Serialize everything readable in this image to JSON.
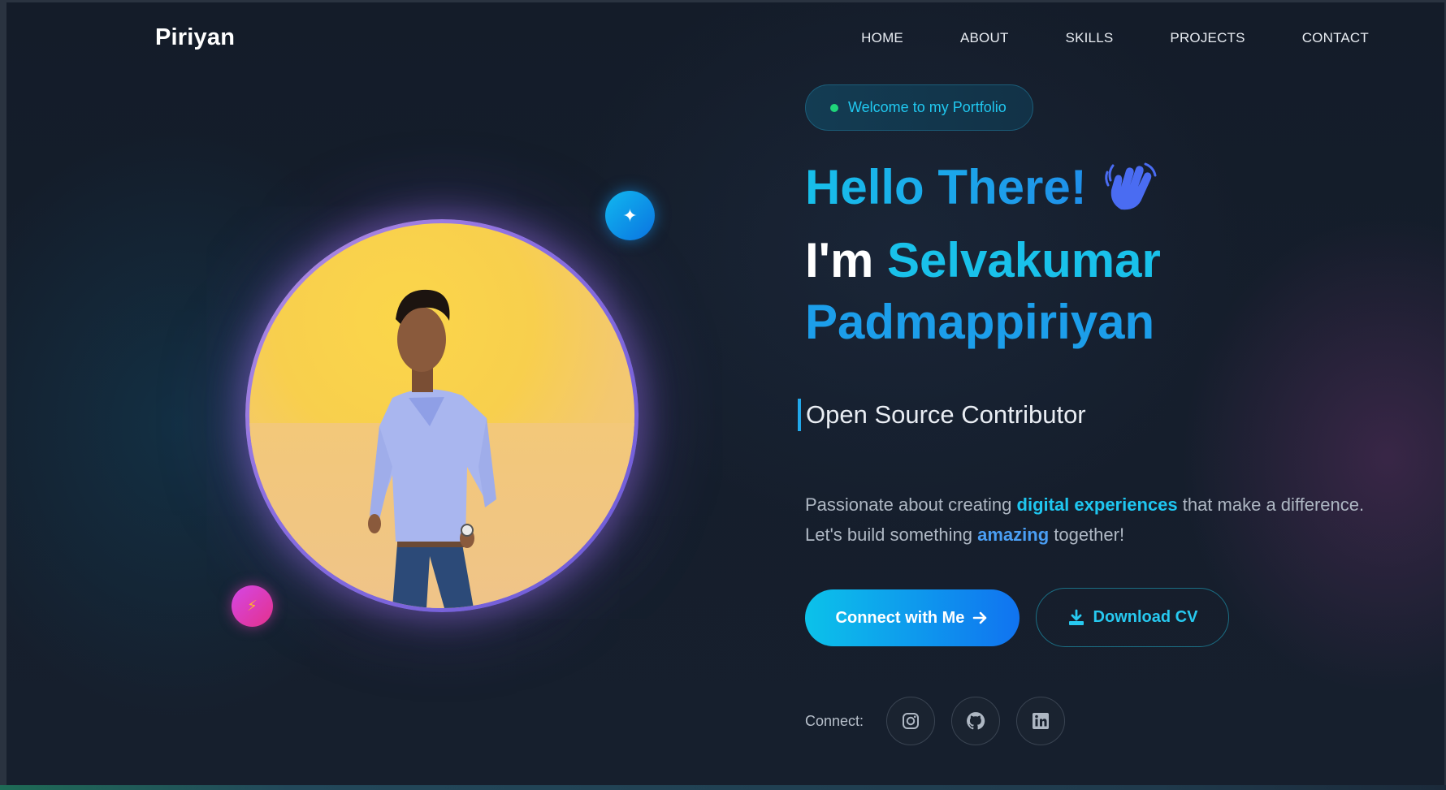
{
  "brand": {
    "logo": "Piriyan"
  },
  "nav": {
    "items": [
      "HOME",
      "ABOUT",
      "SKILLS",
      "PROJECTS",
      "CONTACT"
    ]
  },
  "hero": {
    "welcome_pill": "Welcome to my Portfolio",
    "greeting": "Hello There!",
    "im": "I'm",
    "first_name": "Selvakumar",
    "last_name": "Padmappiriyan",
    "role": "Open Source Contributor",
    "desc": {
      "part1": "Passionate about creating ",
      "hl1": "digital experiences",
      "part2": " that make a difference.",
      "part3": "Let's build something ",
      "hl2": "amazing",
      "part4": " together!"
    },
    "cta_connect": "Connect with Me",
    "cta_cv": "Download CV",
    "connect_label": "Connect:"
  },
  "social": [
    {
      "icon": "instagram-icon"
    },
    {
      "icon": "github-icon"
    },
    {
      "icon": "linkedin-icon"
    }
  ],
  "colors": {
    "background": "#151e2c",
    "accent_cyan": "#19c1ea",
    "accent_blue": "#1c9eea",
    "status_green": "#1fd67a",
    "badge_pink": "#d447e6"
  }
}
